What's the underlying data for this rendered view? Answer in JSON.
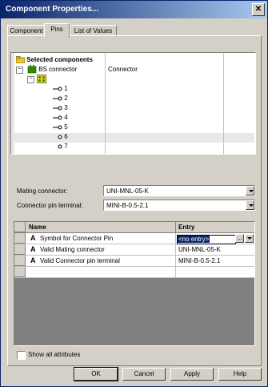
{
  "window": {
    "title": "Component Properties..."
  },
  "tabs": [
    {
      "label": "Component"
    },
    {
      "label": "Pins"
    },
    {
      "label": "List of Values"
    }
  ],
  "tree": {
    "root_label": "Selected components",
    "component_name": "BS connector",
    "component_type": "Connector",
    "pins": [
      "1",
      "2",
      "3",
      "4",
      "5",
      "6",
      "7"
    ]
  },
  "fields": {
    "mating_connector_label": "Mating connector:",
    "mating_connector_value": "UNI-MNL-05-K",
    "pin_terminal_label": "Connector pin terminal:",
    "pin_terminal_value": "MINI-B-0.5-2.1"
  },
  "grid": {
    "col_name": "Name",
    "col_entry": "Entry",
    "rows": [
      {
        "icon": "A",
        "name": "Symbol for Connector Pin",
        "entry": "<no entry>"
      },
      {
        "icon": "A",
        "name": "Valid Mating connector",
        "entry": "UNI-MNL-05-K"
      },
      {
        "icon": "A",
        "name": "Valid Connector pin terminal",
        "entry": "MINI-B-0.5-2.1"
      }
    ]
  },
  "show_all_attributes": "Show all attributes",
  "buttons": {
    "ok": "OK",
    "cancel": "Cancel",
    "apply": "Apply",
    "help": "Help"
  },
  "colors": {
    "title_bg": "#0a246a",
    "selection": "#0a246a",
    "face": "#d4d0c8",
    "connector_icon": "#2e8b00",
    "tree_folder": "#e8c830"
  }
}
